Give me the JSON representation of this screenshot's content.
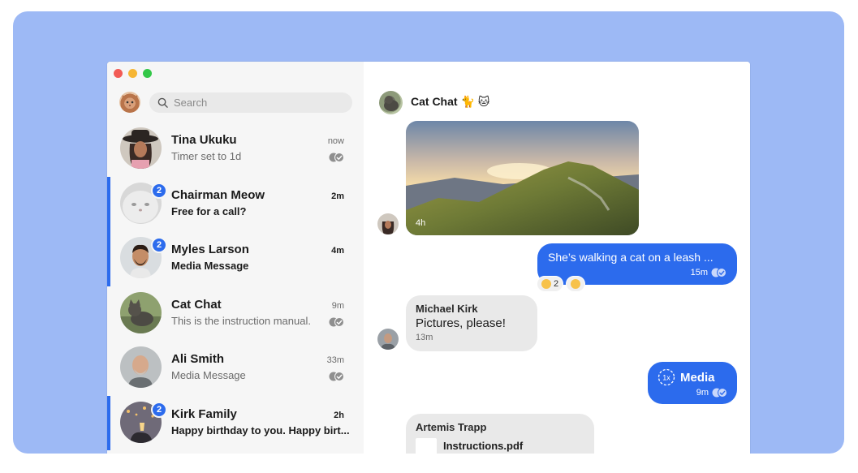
{
  "search": {
    "placeholder": "Search"
  },
  "conversations": [
    {
      "name": "Tina Ukuku",
      "snippet": "Timer set to 1d",
      "time": "now",
      "unread": false,
      "badge": ""
    },
    {
      "name": "Chairman Meow",
      "snippet": "Free for a call?",
      "time": "2m",
      "unread": true,
      "badge": "2"
    },
    {
      "name": "Myles Larson",
      "snippet": "Media Message",
      "time": "4m",
      "unread": true,
      "badge": "2"
    },
    {
      "name": "Cat Chat",
      "snippet": "This is the instruction manual.",
      "time": "9m",
      "unread": false,
      "badge": ""
    },
    {
      "name": "Ali Smith",
      "snippet": "Media Message",
      "time": "33m",
      "unread": false,
      "badge": ""
    },
    {
      "name": "Kirk Family",
      "snippet": "Happy birthday to you. Happy birt...",
      "time": "2h",
      "unread": true,
      "badge": "2"
    }
  ],
  "chat": {
    "title": "Cat Chat 🐈 🐱",
    "messages": {
      "photo": {
        "time": "4h"
      },
      "walking": {
        "text": "She’s walking a cat on a leash ...",
        "time": "15m",
        "reaction_count": "2"
      },
      "michael": {
        "sender": "Michael Kirk",
        "text": "Pictures, please!",
        "time": "13m"
      },
      "media": {
        "view_once": "1x",
        "text": "Media",
        "time": "9m"
      },
      "artemis": {
        "sender": "Artemis Trapp",
        "file": "Instructions.pdf",
        "file_type": "PDF"
      }
    }
  },
  "colors": {
    "accent": "#2c6bed",
    "background": "#9db9f5",
    "sidebar": "#f6f6f6",
    "incoming": "#e9e9e9"
  }
}
